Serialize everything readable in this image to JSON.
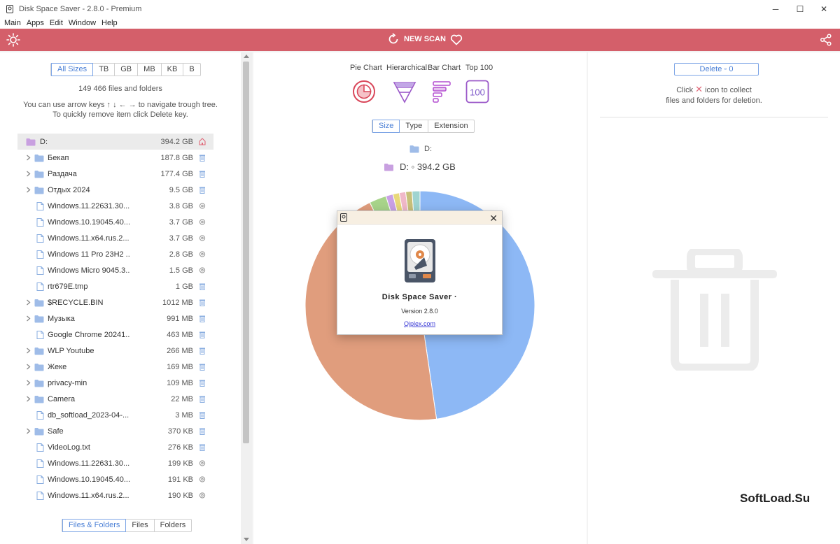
{
  "window": {
    "title": "Disk Space Saver - 2.8.0 - Premium",
    "minimize": "─",
    "maximize": "☐",
    "close": "✕"
  },
  "menu": [
    "Main",
    "Apps",
    "Edit",
    "Window",
    "Help"
  ],
  "toolbar": {
    "scan_label": "NEW SCAN",
    "accent": "#d45f6a"
  },
  "left": {
    "size_filters": [
      "All Sizes",
      "TB",
      "GB",
      "MB",
      "KB",
      "B"
    ],
    "size_filter_active": "All Sizes",
    "count_text": "149 466 files and folders",
    "hint_line1": "You can use arrow keys ↑ ↓ ← → to navigate trough tree.",
    "hint_line2": "To quickly remove item click Delete key.",
    "tree": [
      {
        "name": "D:",
        "size": "394.2 GB",
        "kind": "root"
      },
      {
        "name": "Бекап",
        "size": "187.8 GB",
        "kind": "folder"
      },
      {
        "name": "Раздача",
        "size": "177.4 GB",
        "kind": "folder"
      },
      {
        "name": "Отдых 2024",
        "size": "9.5 GB",
        "kind": "folder"
      },
      {
        "name": "Windows.11.22631.30...",
        "size": "3.8 GB",
        "kind": "file-sys"
      },
      {
        "name": "Windows.10.19045.40...",
        "size": "3.7 GB",
        "kind": "file-sys"
      },
      {
        "name": "Windows.11.x64.rus.2...",
        "size": "3.7 GB",
        "kind": "file-sys"
      },
      {
        "name": "Windows 11 Pro 23H2 ...",
        "size": "2.8 GB",
        "kind": "file-sys"
      },
      {
        "name": "Windows Micro 9045.3...",
        "size": "1.5 GB",
        "kind": "file-sys"
      },
      {
        "name": "rtr679E.tmp",
        "size": "1 GB",
        "kind": "file"
      },
      {
        "name": "$RECYCLE.BIN",
        "size": "1012 MB",
        "kind": "folder"
      },
      {
        "name": "Музыка",
        "size": "991 MB",
        "kind": "folder"
      },
      {
        "name": "Google Chrome 20241...",
        "size": "463 MB",
        "kind": "file"
      },
      {
        "name": "WLP Youtube",
        "size": "266 MB",
        "kind": "folder"
      },
      {
        "name": "Жеке",
        "size": "169 MB",
        "kind": "folder"
      },
      {
        "name": "privacy-min",
        "size": "109 MB",
        "kind": "folder"
      },
      {
        "name": "Camera",
        "size": "22 MB",
        "kind": "folder"
      },
      {
        "name": "db_softload_2023-04-...",
        "size": "3 MB",
        "kind": "file"
      },
      {
        "name": "Safe",
        "size": "370 KB",
        "kind": "folder"
      },
      {
        "name": "VideoLog.txt",
        "size": "276 KB",
        "kind": "file"
      },
      {
        "name": "Windows.11.22631.30...",
        "size": "199 KB",
        "kind": "file-sys"
      },
      {
        "name": "Windows.10.19045.40...",
        "size": "191 KB",
        "kind": "file-sys"
      },
      {
        "name": "Windows.11.x64.rus.2...",
        "size": "190 KB",
        "kind": "file-sys"
      }
    ],
    "bottom_tabs": [
      "Files & Folders",
      "Files",
      "Folders"
    ],
    "bottom_tab_active": "Files & Folders"
  },
  "center": {
    "view_tabs": [
      "Pie Chart",
      "Hierarchical",
      "Bar Chart",
      "Top 100"
    ],
    "top100_icon_text": "100",
    "group_tabs": [
      "Size",
      "Type",
      "Extension"
    ],
    "group_tab_active": "Size",
    "breadcrumb": "D:",
    "current_label": "D: ◦ 394.2 GB",
    "pie_slices": [
      {
        "fraction": 0.477,
        "color": "#8db8f5"
      },
      {
        "fraction": 0.451,
        "color": "#e09d7d"
      },
      {
        "fraction": 0.024,
        "color": "#a8d48a"
      },
      {
        "fraction": 0.01,
        "color": "#c9a0e6"
      },
      {
        "fraction": 0.009,
        "color": "#e8d87a"
      },
      {
        "fraction": 0.009,
        "color": "#f0b8c8"
      },
      {
        "fraction": 0.009,
        "color": "#c8c07a"
      },
      {
        "fraction": 0.011,
        "color": "#9fd4d0"
      }
    ]
  },
  "right": {
    "delete_button": "Delete ◦ 0",
    "hint_pre": "Click",
    "hint_post": "icon to collect",
    "hint_line2": "files and folders for deletion."
  },
  "about": {
    "name": "Disk Space Saver ·",
    "version": "Version 2.8.0",
    "link": "Qiplex.com",
    "close": "✕"
  },
  "watermark": "SoftLoad.Su"
}
